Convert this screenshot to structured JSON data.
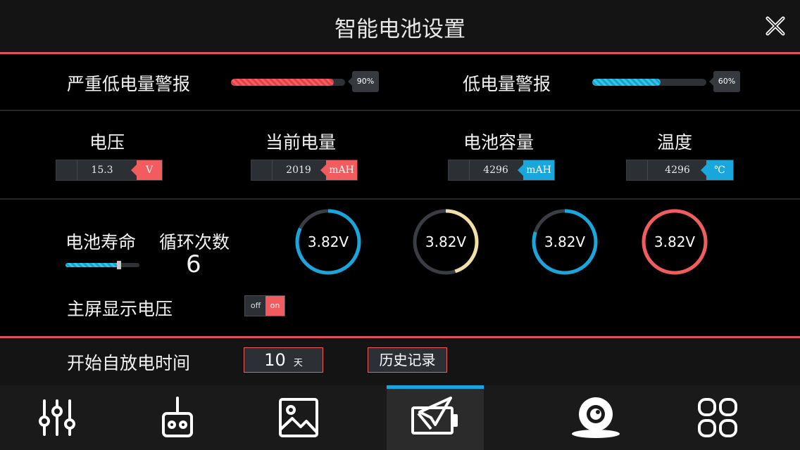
{
  "header": {
    "title": "智能电池设置"
  },
  "alerts": {
    "critical": {
      "label": "严重低电量警报",
      "percent": 90,
      "percent_text": "90%",
      "color": "#f25c5f"
    },
    "low": {
      "label": "低电量警报",
      "percent": 60,
      "percent_text": "60%",
      "color": "#19a6dc"
    }
  },
  "readings": [
    {
      "label": "电压",
      "value": "15.3",
      "unit": "V",
      "accent": "red"
    },
    {
      "label": "当前电量",
      "value": "2019",
      "unit": "mAH",
      "accent": "red"
    },
    {
      "label": "电池容量",
      "value": "4296",
      "unit": "mAH",
      "accent": "blue"
    },
    {
      "label": "温度",
      "value": "4296",
      "unit": "℃",
      "accent": "blue"
    }
  ],
  "life": {
    "label": "电池寿命",
    "level": 0.72
  },
  "cycles": {
    "label": "循环次数",
    "value": "6"
  },
  "cells": [
    {
      "value": "3.82V",
      "color": "#19a6dc",
      "fraction": 0.82
    },
    {
      "value": "3.82V",
      "color": "#f0e0a8",
      "fraction": 0.45
    },
    {
      "value": "3.82V",
      "color": "#19a6dc",
      "fraction": 0.8
    },
    {
      "value": "3.82V",
      "color": "#f25c5f",
      "fraction": 1.0
    }
  ],
  "display_voltage": {
    "label": "主屏显示电压",
    "off_label": "off",
    "on_label": "on",
    "state": "on"
  },
  "self_discharge": {
    "label": "开始自放电时间",
    "value": "10",
    "unit": "天"
  },
  "history_button": {
    "label": "历史记录"
  },
  "nav": [
    {
      "icon": "sliders-icon",
      "active": false
    },
    {
      "icon": "remote-controller-icon",
      "active": false
    },
    {
      "icon": "image-icon",
      "active": false
    },
    {
      "icon": "battery-icon",
      "active": true
    },
    {
      "icon": "camera-icon",
      "active": false
    },
    {
      "icon": "grid-icon",
      "active": false
    }
  ],
  "colors": {
    "accent_red": "#f25c5f",
    "accent_blue": "#19a6dc"
  }
}
